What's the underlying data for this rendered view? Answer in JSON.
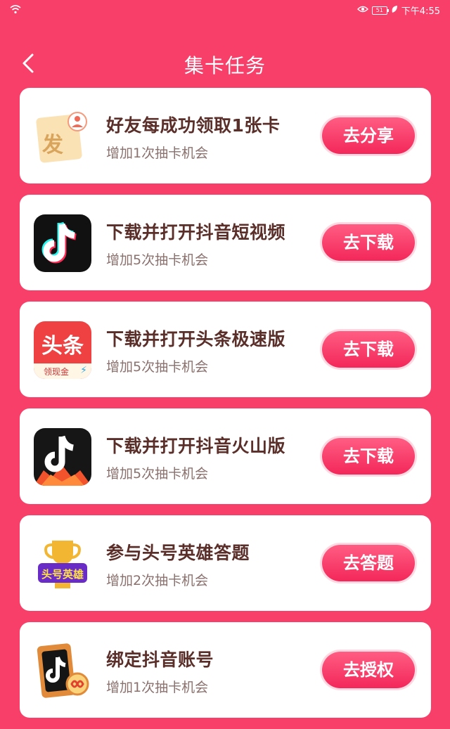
{
  "status": {
    "time": "下午4:55",
    "battery": "51"
  },
  "header": {
    "title": "集卡任务"
  },
  "tasks": [
    {
      "title": "好友每成功领取1张卡",
      "subtitle": "增加1次抽卡机会",
      "button": "去分享",
      "icon": "send-card-icon",
      "icon_text": "发"
    },
    {
      "title": "下载并打开抖音短视频",
      "subtitle": "增加5次抽卡机会",
      "button": "去下载",
      "icon": "douyin-app-icon"
    },
    {
      "title": "下载并打开头条极速版",
      "subtitle": "增加5次抽卡机会",
      "button": "去下载",
      "icon": "toutiao-lite-app-icon",
      "icon_text": "头条",
      "icon_subtext": "领现金"
    },
    {
      "title": "下载并打开抖音火山版",
      "subtitle": "增加5次抽卡机会",
      "button": "去下载",
      "icon": "douyin-huoshan-app-icon"
    },
    {
      "title": "参与头号英雄答题",
      "subtitle": "增加2次抽卡机会",
      "button": "去答题",
      "icon": "trophy-hero-icon",
      "icon_text": "头号英雄"
    },
    {
      "title": "绑定抖音账号",
      "subtitle": "增加1次抽卡机会",
      "button": "去授权",
      "icon": "bind-douyin-icon"
    }
  ],
  "colors": {
    "background": "#f83f6a",
    "title_text": "#5a2f2a",
    "button": "#f3275a"
  }
}
